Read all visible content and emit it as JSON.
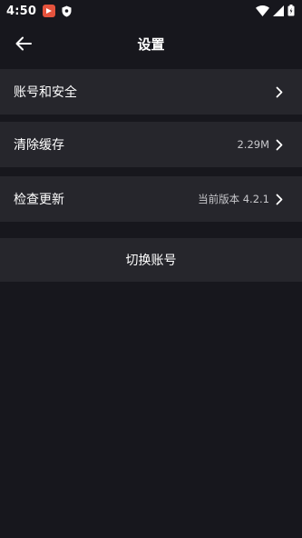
{
  "status_bar": {
    "time": "4:50",
    "icons": [
      "app-notification-icon",
      "shield-icon",
      "wifi-icon",
      "signal-icon",
      "battery-icon"
    ]
  },
  "header": {
    "title": "设置",
    "back_icon": "arrow-left-icon"
  },
  "settings": {
    "account_security": {
      "label": "账号和安全"
    },
    "clear_cache": {
      "label": "清除缓存",
      "value": "2.29M"
    },
    "check_update": {
      "label": "检查更新",
      "value": "当前版本 4.2.1"
    }
  },
  "switch_account": {
    "label": "切换账号"
  },
  "colors": {
    "background": "#17171d",
    "row_background": "#26262c",
    "text_primary": "#ffffff",
    "text_secondary": "#c8c8cc",
    "app_badge": "#e5533d"
  }
}
